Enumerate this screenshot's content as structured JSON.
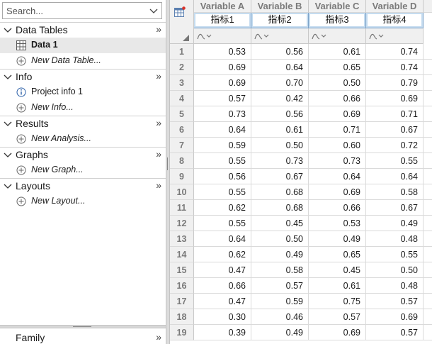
{
  "search": {
    "placeholder": "Search..."
  },
  "sidebar": {
    "sections": [
      {
        "title": "Data Tables",
        "items": [
          {
            "label": "Data 1",
            "selected": true,
            "icon": "table-icon"
          },
          {
            "label": "New Data Table...",
            "new": true,
            "icon": "plus-circle-icon"
          }
        ]
      },
      {
        "title": "Info",
        "items": [
          {
            "label": "Project info 1",
            "icon": "info-icon"
          },
          {
            "label": "New Info...",
            "new": true,
            "icon": "plus-circle-icon"
          }
        ]
      },
      {
        "title": "Results",
        "items": [
          {
            "label": "New Analysis...",
            "new": true,
            "icon": "plus-circle-icon"
          }
        ]
      },
      {
        "title": "Graphs",
        "items": [
          {
            "label": "New Graph...",
            "new": true,
            "icon": "plus-circle-icon"
          }
        ]
      },
      {
        "title": "Layouts",
        "items": [
          {
            "label": "New Layout...",
            "new": true,
            "icon": "plus-circle-icon"
          }
        ]
      }
    ],
    "more_glyph": "»",
    "family_title": "Family"
  },
  "grid": {
    "columns": [
      {
        "header": "Variable A",
        "title": "指标1"
      },
      {
        "header": "Variable B",
        "title": "指标2"
      },
      {
        "header": "Variable C",
        "title": "指标3"
      },
      {
        "header": "Variable D",
        "title": "指标4"
      },
      {
        "header": "V",
        "title": ""
      }
    ],
    "rows": [
      {
        "num": "1",
        "values": [
          "0.53",
          "0.56",
          "0.61",
          "0.74"
        ]
      },
      {
        "num": "2",
        "values": [
          "0.69",
          "0.64",
          "0.65",
          "0.74"
        ]
      },
      {
        "num": "3",
        "values": [
          "0.69",
          "0.70",
          "0.50",
          "0.79"
        ]
      },
      {
        "num": "4",
        "values": [
          "0.57",
          "0.42",
          "0.66",
          "0.69"
        ]
      },
      {
        "num": "5",
        "values": [
          "0.73",
          "0.56",
          "0.69",
          "0.71"
        ]
      },
      {
        "num": "6",
        "values": [
          "0.64",
          "0.61",
          "0.71",
          "0.67"
        ]
      },
      {
        "num": "7",
        "values": [
          "0.59",
          "0.50",
          "0.60",
          "0.72"
        ]
      },
      {
        "num": "8",
        "values": [
          "0.55",
          "0.73",
          "0.73",
          "0.55"
        ]
      },
      {
        "num": "9",
        "values": [
          "0.56",
          "0.67",
          "0.64",
          "0.64"
        ]
      },
      {
        "num": "10",
        "values": [
          "0.55",
          "0.68",
          "0.69",
          "0.58"
        ]
      },
      {
        "num": "11",
        "values": [
          "0.62",
          "0.68",
          "0.66",
          "0.67"
        ]
      },
      {
        "num": "12",
        "values": [
          "0.55",
          "0.45",
          "0.53",
          "0.49"
        ]
      },
      {
        "num": "13",
        "values": [
          "0.64",
          "0.50",
          "0.49",
          "0.48"
        ]
      },
      {
        "num": "14",
        "values": [
          "0.62",
          "0.49",
          "0.65",
          "0.55"
        ]
      },
      {
        "num": "15",
        "values": [
          "0.47",
          "0.58",
          "0.45",
          "0.50"
        ]
      },
      {
        "num": "16",
        "values": [
          "0.66",
          "0.57",
          "0.61",
          "0.48"
        ]
      },
      {
        "num": "17",
        "values": [
          "0.47",
          "0.59",
          "0.75",
          "0.57"
        ]
      },
      {
        "num": "18",
        "values": [
          "0.30",
          "0.46",
          "0.57",
          "0.69"
        ]
      },
      {
        "num": "19",
        "values": [
          "0.39",
          "0.49",
          "0.69",
          "0.57"
        ]
      }
    ]
  },
  "colors": {
    "title_row_bg": "#c5dcf0",
    "header_bg": "#f0f0f0",
    "selected_item_bg": "#e8e8e8"
  }
}
